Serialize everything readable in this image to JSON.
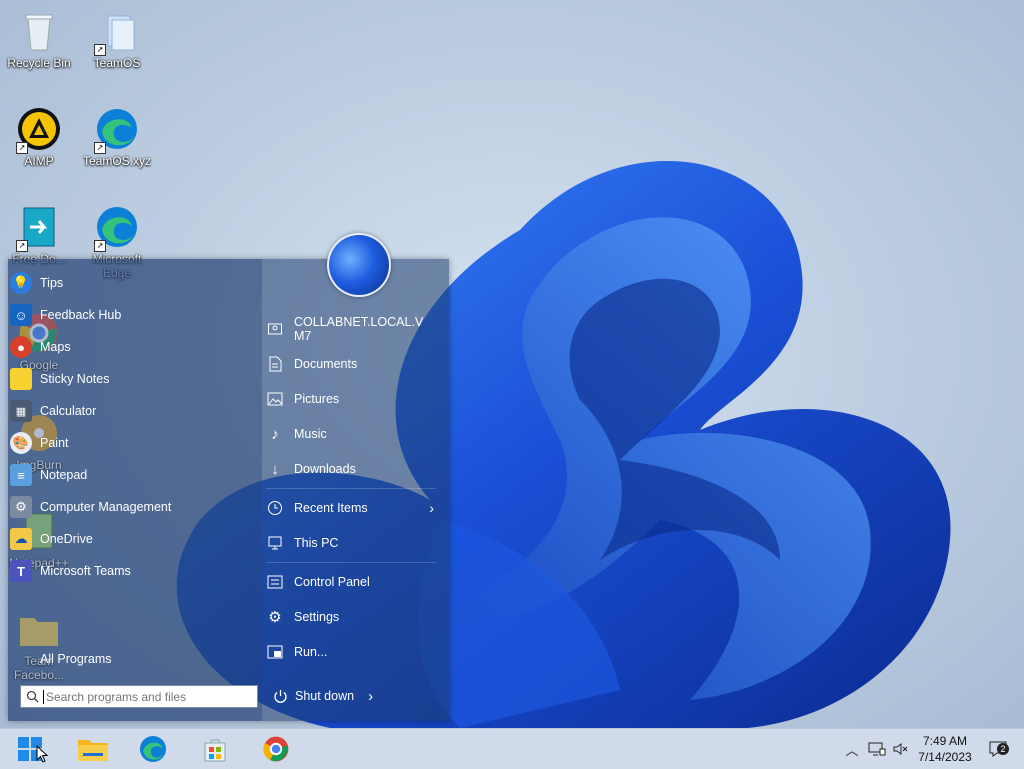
{
  "desktop": {
    "icons": [
      {
        "label": "Recycle Bin"
      },
      {
        "label": "TeamOS"
      },
      {
        "label": "AIMP"
      },
      {
        "label": "TeamOS.xyz"
      },
      {
        "label": "Free Do..."
      },
      {
        "label": "Microsoft Edge"
      },
      {
        "label": "Google"
      },
      {
        "label": "ImgBurn"
      },
      {
        "label": "Notepad++"
      },
      {
        "label": "Team Facebo..."
      }
    ]
  },
  "start_menu": {
    "programs": [
      {
        "label": "Tips",
        "icon": "lightbulb-icon"
      },
      {
        "label": "Feedback Hub",
        "icon": "feedback-icon"
      },
      {
        "label": "Maps",
        "icon": "map-pin-icon"
      },
      {
        "label": "Sticky Notes",
        "icon": "sticky-note-icon"
      },
      {
        "label": "Calculator",
        "icon": "calculator-icon"
      },
      {
        "label": "Paint",
        "icon": "paint-icon"
      },
      {
        "label": "Notepad",
        "icon": "notepad-icon"
      },
      {
        "label": "Computer Management",
        "icon": "computer-management-icon"
      },
      {
        "label": "OneDrive",
        "icon": "onedrive-icon"
      },
      {
        "label": "Microsoft Teams",
        "icon": "teams-icon"
      }
    ],
    "all_programs_label": "All Programs",
    "search_placeholder": "Search programs and files",
    "places": [
      {
        "label": "COLLABNET.LOCAL.VM7",
        "line1": "COLLABNET.LOCAL.V",
        "line2": "M7"
      },
      {
        "label": "Documents"
      },
      {
        "label": "Pictures"
      },
      {
        "label": "Music"
      },
      {
        "label": "Downloads"
      },
      {
        "label": "Recent Items"
      },
      {
        "label": "This PC"
      },
      {
        "label": "Control Panel"
      },
      {
        "label": "Settings"
      },
      {
        "label": "Run..."
      }
    ],
    "shutdown_label": "Shut down"
  },
  "taskbar": {
    "apps": [
      "Start",
      "File Explorer",
      "Microsoft Edge",
      "Microsoft Store",
      "Google Chrome"
    ],
    "clock_time": "7:49 AM",
    "clock_date": "7/14/2023",
    "notification_count": "2"
  },
  "colors": {
    "accent": "#1f5de0",
    "taskbar": "#d2dceb"
  }
}
